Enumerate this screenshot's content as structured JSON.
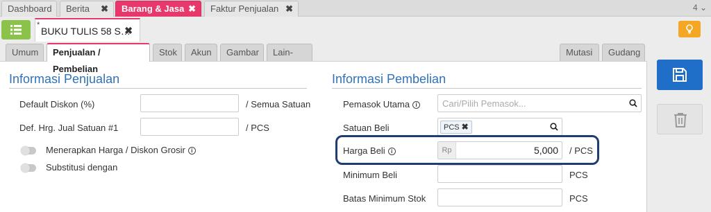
{
  "top_tabs": [
    {
      "label": "Dashboard",
      "closable": false,
      "active": false
    },
    {
      "label": "Berita",
      "closable": true,
      "active": false
    },
    {
      "label": "Barang & Jasa",
      "closable": true,
      "active": true
    },
    {
      "label": "Faktur Penjualan",
      "closable": true,
      "active": false
    }
  ],
  "top_tab_count": "4 ⌄",
  "doc_tab": {
    "modified_marker": "*",
    "title": "BUKU TULIS 58 S…"
  },
  "sub_tabs_left": [
    "Umum",
    "Penjualan / Pembelian",
    "Stok",
    "Akun",
    "Gambar",
    "Lain-lain"
  ],
  "sub_tabs_right": [
    "Mutasi",
    "Gudang"
  ],
  "penjualan": {
    "title": "Informasi Penjualan",
    "default_diskon_label": "Default Diskon (%)",
    "default_diskon_value": "",
    "default_diskon_unit": "/ Semua Satuan",
    "def_harga_label": "Def. Hrg. Jual Satuan #1",
    "def_harga_value": "",
    "def_harga_unit": "/ PCS",
    "grosir_label": "Menerapkan Harga / Diskon Grosir",
    "substitusi_label": "Substitusi dengan"
  },
  "pembelian": {
    "title": "Informasi Pembelian",
    "pemasok_label": "Pemasok Utama",
    "pemasok_placeholder": "Cari/Pilih Pemasok...",
    "satuan_label": "Satuan Beli",
    "satuan_chip": "PCS",
    "harga_label": "Harga Beli",
    "harga_prefix": "Rp",
    "harga_value": "5,000",
    "harga_unit": "/ PCS",
    "min_beli_label": "Minimum Beli",
    "min_beli_unit": "PCS",
    "batas_label": "Batas Minimum Stok",
    "batas_unit": "PCS"
  },
  "colors": {
    "accent": "#e8386b",
    "primary": "#1f6fc8",
    "section_title": "#2f72b8",
    "menu_button": "#8bc34a",
    "bulb_button": "#f5a623",
    "highlight_border": "#1f3d73"
  },
  "icons": [
    "list-menu-icon",
    "lightbulb-icon",
    "search-icon",
    "info-icon",
    "save-icon",
    "trash-icon",
    "close-icon"
  ]
}
